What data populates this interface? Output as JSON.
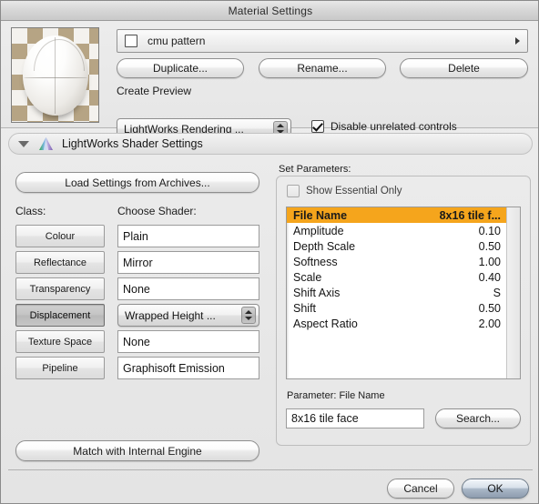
{
  "window": {
    "title": "Material Settings"
  },
  "preview": {
    "icon_name": "material-sphere-preview"
  },
  "material": {
    "name": "cmu pattern",
    "name_checkbox_checked": false,
    "disclosure_icon": "triangle-right-icon"
  },
  "toolbar": {
    "duplicate_label": "Duplicate...",
    "rename_label": "Rename...",
    "delete_label": "Delete"
  },
  "create_preview": {
    "label": "Create Preview",
    "engine_value": "LightWorks Rendering ...",
    "stepper_icon": "updown-arrows-icon",
    "disable_unrelated_label": "Disable unrelated controls",
    "disable_unrelated_checked": true
  },
  "section": {
    "title": "LightWorks Shader Settings",
    "disclosure_icon": "triangle-down-icon",
    "app_icon": "lightworks-prism-icon",
    "expanded": true
  },
  "left_panel": {
    "load_settings_label": "Load Settings from Archives...",
    "class_label": "Class:",
    "shader_label": "Choose Shader:",
    "classes": [
      {
        "label": "Colour",
        "selected": false
      },
      {
        "label": "Reflectance",
        "selected": false
      },
      {
        "label": "Transparency",
        "selected": false
      },
      {
        "label": "Displacement",
        "selected": true
      },
      {
        "label": "Texture Space",
        "selected": false
      },
      {
        "label": "Pipeline",
        "selected": false
      }
    ],
    "shaders": [
      {
        "value": "Plain",
        "type": "field"
      },
      {
        "value": "Mirror",
        "type": "field"
      },
      {
        "value": "None",
        "type": "field"
      },
      {
        "value": "Wrapped Height ...",
        "type": "popup"
      },
      {
        "value": "None",
        "type": "field"
      },
      {
        "value": "Graphisoft Emission",
        "type": "field"
      }
    ],
    "match_engine_label": "Match with Internal Engine"
  },
  "right_panel": {
    "set_parameters_label": "Set Parameters:",
    "show_essential_label": "Show Essential Only",
    "show_essential_checked": false,
    "parameters": [
      {
        "name": "File Name",
        "value": "8x16 tile f...",
        "selected": true
      },
      {
        "name": "Amplitude",
        "value": "0.10",
        "selected": false
      },
      {
        "name": "Depth Scale",
        "value": "0.50",
        "selected": false
      },
      {
        "name": "Softness",
        "value": "1.00",
        "selected": false
      },
      {
        "name": "Scale",
        "value": "0.40",
        "selected": false
      },
      {
        "name": "Shift Axis",
        "value": "S",
        "selected": false
      },
      {
        "name": "Shift",
        "value": "0.50",
        "selected": false
      },
      {
        "name": "Aspect Ratio",
        "value": "2.00",
        "selected": false
      }
    ],
    "parameter_label": "Parameter: File Name",
    "parameter_value": "8x16 tile face",
    "search_label": "Search..."
  },
  "footer": {
    "cancel_label": "Cancel",
    "ok_label": "OK",
    "default_button": "OK"
  },
  "colors": {
    "selection_orange": "#f5a51c",
    "window_bg": "#e8e8e8",
    "default_button_blue": "#aab8c8",
    "checker_tan": "#b6a484"
  }
}
